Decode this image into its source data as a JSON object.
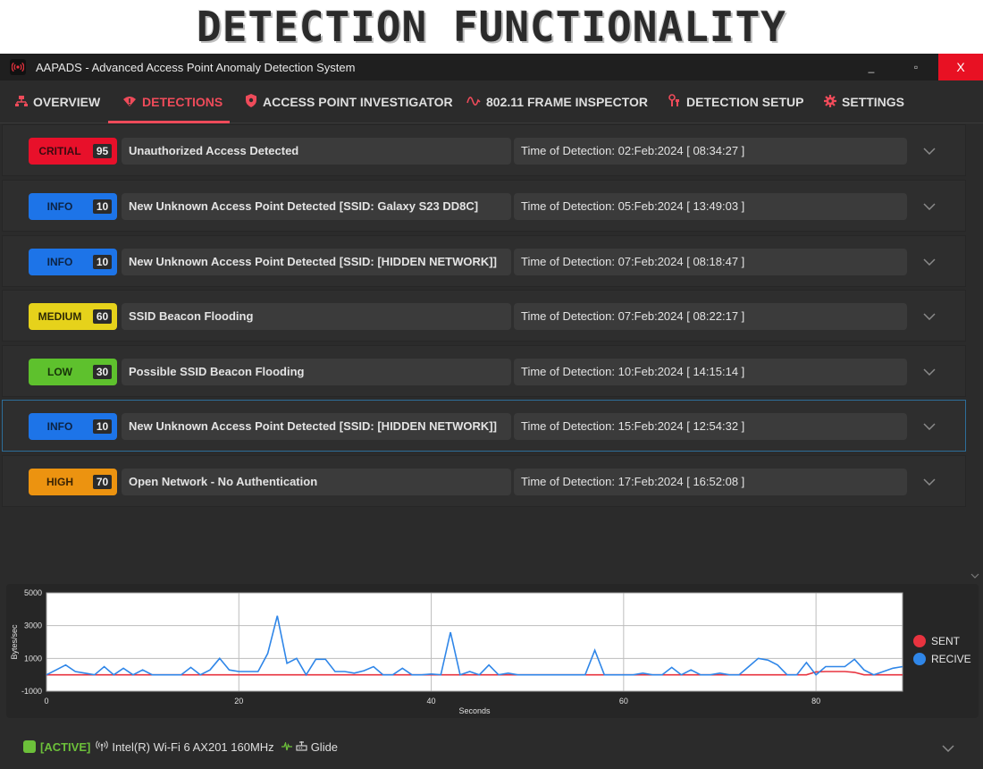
{
  "banner": {
    "text": "DETECTION FUNCTIONALITY"
  },
  "window": {
    "title": "AAPADS - Advanced Access Point Anomaly Detection System",
    "minimize": "_",
    "maximize": "▫",
    "close": "X"
  },
  "tabs": [
    {
      "label": "OVERVIEW",
      "icon": "network-icon"
    },
    {
      "label": "DETECTIONS",
      "icon": "wifi-alert-icon",
      "active": true
    },
    {
      "label": "ACCESS POINT INVESTIGATOR",
      "icon": "shield-icon"
    },
    {
      "label": "802.11 FRAME INSPECTOR",
      "icon": "wave-icon"
    },
    {
      "label": "DETECTION SETUP",
      "icon": "tools-icon"
    },
    {
      "label": "SETTINGS",
      "icon": "gear-icon"
    }
  ],
  "detections": [
    {
      "severity": "CRITIAL",
      "score": "95",
      "title": "Unauthorized Access Detected",
      "time": "Time of Detection: 02:Feb:2024 [ 08:34:27 ]"
    },
    {
      "severity": "INFO",
      "score": "10",
      "title": "New Unknown Access Point Detected [SSID: Galaxy S23 DD8C]",
      "time": "Time of Detection: 05:Feb:2024 [ 13:49:03 ]"
    },
    {
      "severity": "INFO",
      "score": "10",
      "title": "New Unknown Access Point Detected [SSID: [HIDDEN NETWORK]]",
      "time": "Time of Detection: 07:Feb:2024 [ 08:18:47 ]"
    },
    {
      "severity": "MEDIUM",
      "score": "60",
      "title": "SSID Beacon Flooding",
      "time": "Time of Detection: 07:Feb:2024 [ 08:22:17 ]"
    },
    {
      "severity": "LOW",
      "score": "30",
      "title": "Possible SSID Beacon Flooding",
      "time": "Time of Detection: 10:Feb:2024 [ 14:15:14 ]"
    },
    {
      "severity": "INFO",
      "score": "10",
      "title": "New Unknown Access Point Detected [SSID: [HIDDEN NETWORK]]",
      "time": "Time of Detection: 15:Feb:2024 [ 12:54:32 ]",
      "selected": true
    },
    {
      "severity": "HIGH",
      "score": "70",
      "title": "Open Network - No Authentication",
      "time": "Time of Detection: 17:Feb:2024 [ 16:52:08 ]"
    }
  ],
  "severity_colors": {
    "CRITIAL": {
      "bg": "#e8102a",
      "fg": "#3a0a10"
    },
    "INFO": {
      "bg": "#1d74e8",
      "fg": "#0c2344"
    },
    "MEDIUM": {
      "bg": "#e6d21b",
      "fg": "#2e2a05"
    },
    "LOW": {
      "bg": "#5ec12d",
      "fg": "#173309"
    },
    "HIGH": {
      "bg": "#ec9310",
      "fg": "#3a2304"
    }
  },
  "chart_data": {
    "type": "line",
    "xlabel": "Seconds",
    "ylabel": "Bytes/sec",
    "xlim": [
      0,
      89
    ],
    "ylim": [
      -1000,
      5000
    ],
    "xticks": [
      0,
      20,
      40,
      60,
      80
    ],
    "yticks": [
      -1000,
      1000,
      3000,
      5000
    ],
    "grid": true,
    "legend_position": "right",
    "series": [
      {
        "name": "SENT",
        "color": "#e8333f",
        "x": [
          0,
          10,
          20,
          30,
          40,
          50,
          60,
          70,
          79,
          80,
          81,
          82,
          83,
          84,
          85,
          89
        ],
        "y": [
          0,
          0,
          0,
          0,
          0,
          0,
          0,
          0,
          0,
          180,
          200,
          200,
          200,
          150,
          0,
          0
        ]
      },
      {
        "name": "RECIVE",
        "color": "#2f86e8",
        "x": [
          0,
          1,
          2,
          3,
          4,
          5,
          6,
          7,
          8,
          9,
          10,
          11,
          12,
          13,
          14,
          15,
          16,
          17,
          18,
          19,
          20,
          21,
          22,
          23,
          24,
          25,
          26,
          27,
          28,
          29,
          30,
          31,
          32,
          33,
          34,
          35,
          36,
          37,
          38,
          39,
          40,
          41,
          42,
          43,
          44,
          45,
          46,
          47,
          48,
          49,
          50,
          51,
          52,
          53,
          54,
          55,
          56,
          57,
          58,
          59,
          60,
          61,
          62,
          63,
          64,
          65,
          66,
          67,
          68,
          69,
          70,
          71,
          72,
          73,
          74,
          75,
          76,
          77,
          78,
          79,
          80,
          81,
          82,
          83,
          84,
          85,
          86,
          87,
          88,
          89
        ],
        "y": [
          0,
          300,
          600,
          200,
          100,
          0,
          500,
          0,
          400,
          0,
          300,
          0,
          0,
          0,
          0,
          450,
          0,
          300,
          1000,
          300,
          200,
          200,
          200,
          1300,
          3600,
          700,
          1000,
          0,
          950,
          950,
          200,
          200,
          100,
          250,
          500,
          0,
          0,
          400,
          0,
          0,
          50,
          0,
          2600,
          0,
          200,
          0,
          600,
          0,
          100,
          0,
          0,
          0,
          0,
          0,
          0,
          0,
          0,
          1500,
          0,
          0,
          0,
          0,
          100,
          0,
          0,
          450,
          0,
          300,
          0,
          0,
          100,
          0,
          0,
          500,
          1000,
          900,
          600,
          0,
          0,
          750,
          0,
          500,
          500,
          500,
          950,
          300,
          0,
          200,
          400,
          500
        ]
      }
    ]
  },
  "status": {
    "active": "[ACTIVE]",
    "adapter": "Intel(R) Wi-Fi 6 AX201 160MHz",
    "profile": "Glide"
  }
}
